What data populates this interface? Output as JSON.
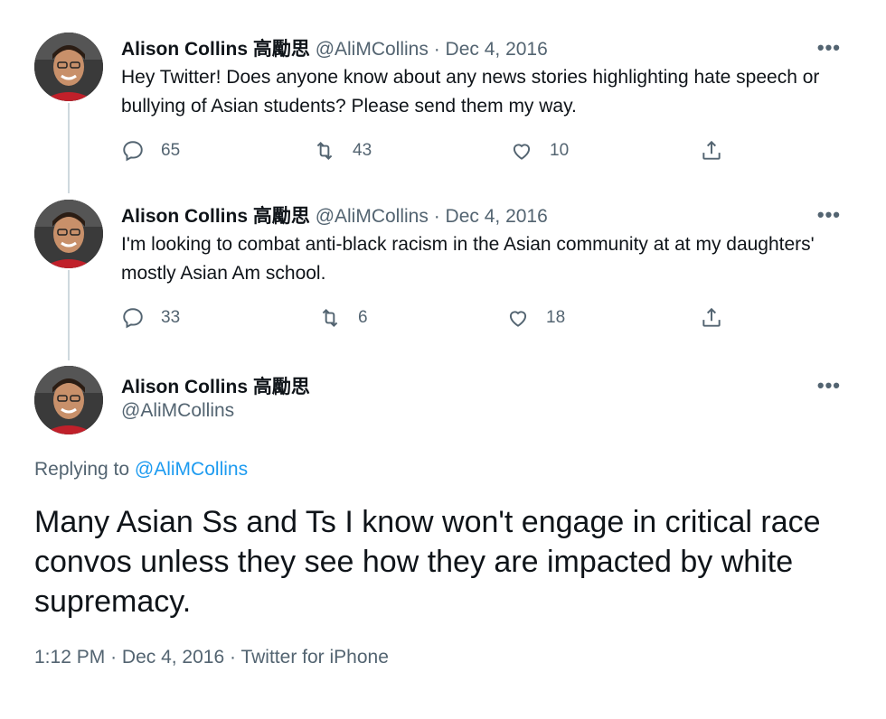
{
  "tweets": [
    {
      "name": "Alison Collins 高勵思",
      "handle": "@AliMCollins",
      "separator": "·",
      "date": "Dec 4, 2016",
      "text": "Hey Twitter! Does anyone know about any news stories highlighting hate speech or bullying of Asian students? Please send them my way.",
      "replies": "65",
      "retweets": "43",
      "likes": "10",
      "more": "•••"
    },
    {
      "name": "Alison Collins 高勵思",
      "handle": "@AliMCollins",
      "separator": "·",
      "date": "Dec 4, 2016",
      "text": "I'm looking to combat anti-black racism in the Asian community at at my daughters' mostly Asian Am school.",
      "replies": "33",
      "retweets": "6",
      "likes": "18",
      "more": "•••"
    }
  ],
  "main_tweet": {
    "name": "Alison Collins 高勵思",
    "handle": "@AliMCollins",
    "more": "•••",
    "replying_prefix": "Replying to ",
    "replying_to": "@AliMCollins",
    "text": "Many Asian Ss and Ts I know won't engage in critical race convos unless they see how they are impacted by white supremacy.",
    "time": "1:12 PM",
    "separator": "·",
    "date": "Dec 4, 2016",
    "source": "Twitter for iPhone"
  },
  "colors": {
    "text": "#0f1419",
    "secondary": "#536471",
    "link": "#1d9bf0",
    "thread": "#cfd9de"
  }
}
